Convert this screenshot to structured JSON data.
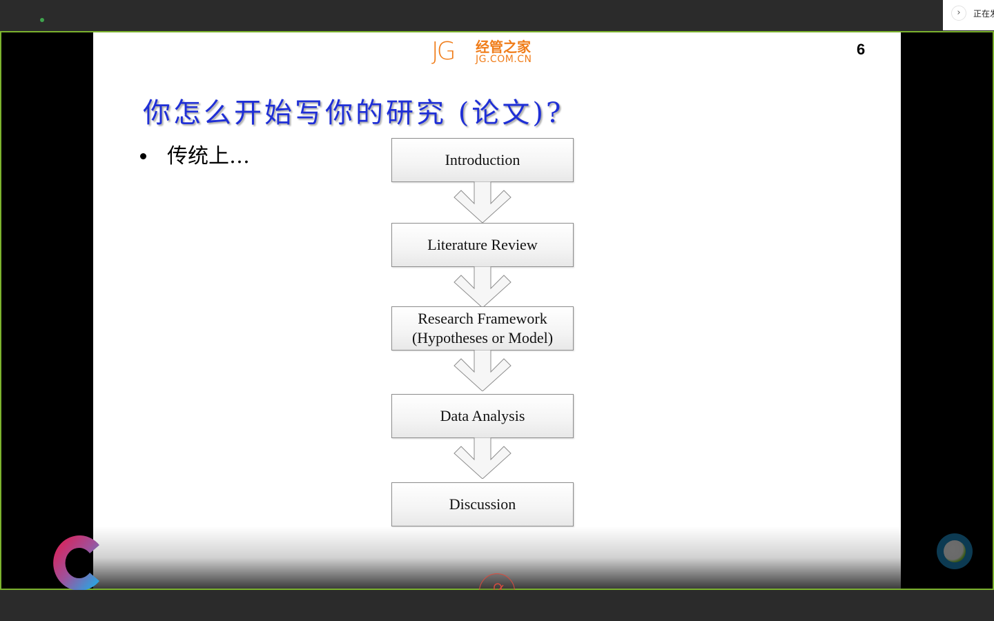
{
  "topbar": {
    "status_dot_color": "#3fa34d",
    "live_panel": {
      "chevron_icon": "›",
      "label": "正在发"
    }
  },
  "slide": {
    "logo": {
      "mark": "JG",
      "name_cn": "经管之家",
      "url": "JG.COM.CN"
    },
    "page_number": "6",
    "title": "你怎么开始写你的研究 (论文)?",
    "bullet": "传统上…",
    "flowchart": {
      "steps": [
        {
          "label": "Introduction"
        },
        {
          "label": "Literature Review"
        },
        {
          "label": "Research Framework (Hypotheses or Model)",
          "line1": "Research Framework",
          "line2": "(Hypotheses or Model)"
        },
        {
          "label": "Data Analysis"
        },
        {
          "label": "Discussion"
        }
      ],
      "connector": "down-arrow"
    }
  },
  "overlay": {
    "brand_icon": "c-logo-icon",
    "mic_icon": "mic-muted-icon",
    "avatar_icon": "user-avatar-icon"
  },
  "colors": {
    "frame_border": "#7cb32e",
    "title_blue": "#1f2fd6",
    "logo_orange": "#f07d1a",
    "mic_red": "#d94b3e"
  }
}
